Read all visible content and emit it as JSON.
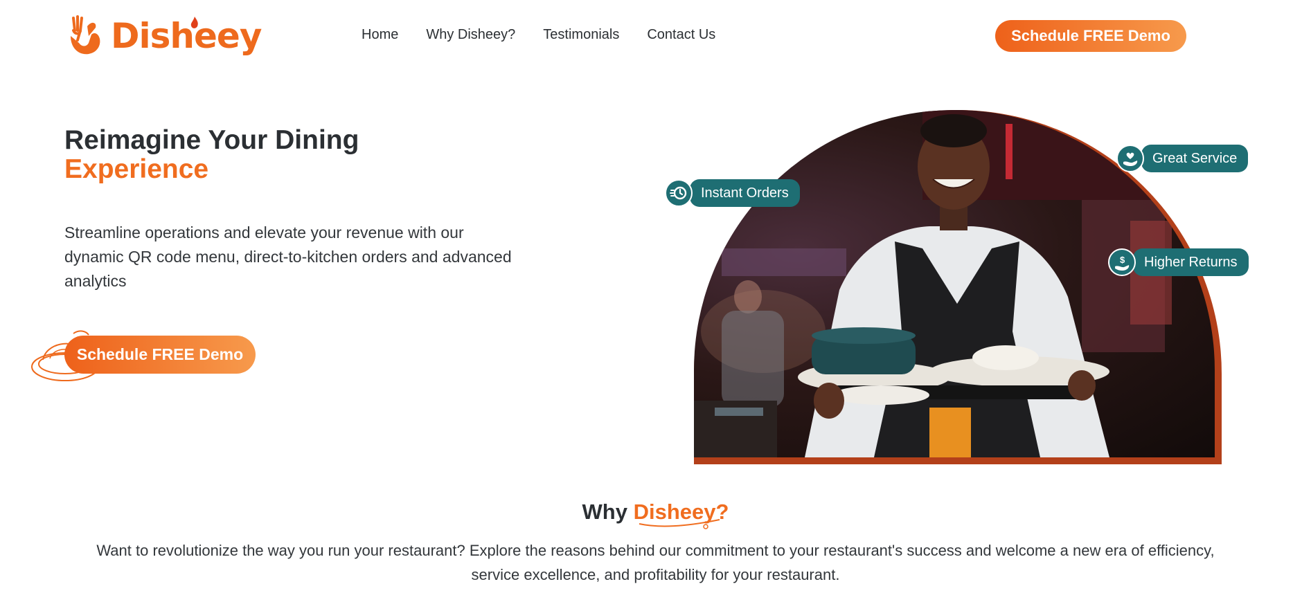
{
  "brand": {
    "name": "Disheey",
    "color": "#ee6a1d"
  },
  "nav": {
    "items": [
      {
        "label": "Home"
      },
      {
        "label": "Why Disheey?"
      },
      {
        "label": "Testimonials"
      },
      {
        "label": "Contact Us"
      }
    ]
  },
  "header": {
    "cta_label": "Schedule FREE Demo"
  },
  "hero": {
    "title_line1": "Reimagine Your Dining",
    "title_line2": "Experience",
    "description": "Streamline operations and elevate your revenue with our dynamic QR code menu, direct-to-kitchen orders and advanced analytics",
    "cta_label": "Schedule FREE Demo",
    "image_icon": "dish-icon"
  },
  "badges": [
    {
      "label": "Instant Orders",
      "icon": "clock-icon"
    },
    {
      "label": "Great Service",
      "icon": "heart-hand-icon"
    },
    {
      "label": "Higher Returns",
      "icon": "money-hand-icon"
    }
  ],
  "why": {
    "title_prefix": "Why",
    "title_accent": "Disheey?",
    "description": "Want to revolutionize the way you run your restaurant? Explore the reasons behind our commitment to your restaurant's success and welcome a new era of efficiency, service excellence, and profitability for your restaurant."
  },
  "colors": {
    "accent": "#f06d1f",
    "teal": "#1e6e73",
    "arch_border": "#b3401a",
    "text": "#2b2f33"
  }
}
